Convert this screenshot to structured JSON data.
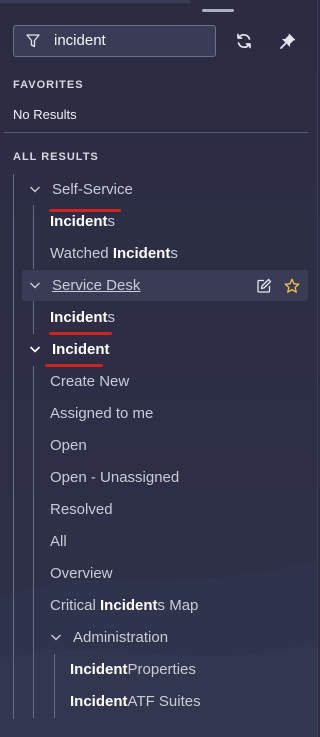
{
  "search": {
    "value": "incident"
  },
  "sections": {
    "favorites": "FAVORITES",
    "no_results": "No Results",
    "all_results": "ALL RESULTS"
  },
  "tree": {
    "self_service": {
      "label": "Self-Service",
      "items": [
        {
          "bold": "Incident",
          "rest": "s"
        },
        {
          "pre": "Watched ",
          "bold": "Incident",
          "rest": "s"
        }
      ]
    },
    "service_desk": {
      "label": "Service Desk",
      "items": [
        {
          "bold": "Incident",
          "rest": "s"
        }
      ]
    },
    "incident": {
      "label": "Incident",
      "items": [
        {
          "label": "Create New"
        },
        {
          "label": "Assigned to me"
        },
        {
          "label": "Open"
        },
        {
          "label": "Open - Unassigned"
        },
        {
          "label": "Resolved"
        },
        {
          "label": "All"
        },
        {
          "label": "Overview"
        },
        {
          "pre": "Critical ",
          "bold": "Incident",
          "rest": "s Map"
        }
      ],
      "administration": {
        "label": "Administration",
        "items": [
          {
            "bold": "Incident",
            "rest": " Properties"
          },
          {
            "bold": "Incident",
            "rest": " ATF Suites"
          }
        ]
      }
    }
  },
  "colors": {
    "background": "#2b2c42",
    "highlight": "#3a3b55",
    "accent_star": "#f2c14e",
    "annotation_red": "#d32222"
  },
  "icons": {
    "filter": "filter-icon",
    "refresh": "refresh-icon",
    "pin": "pin-icon",
    "edit": "edit-icon",
    "star": "star-icon",
    "chevron": "chevron-down-icon"
  }
}
